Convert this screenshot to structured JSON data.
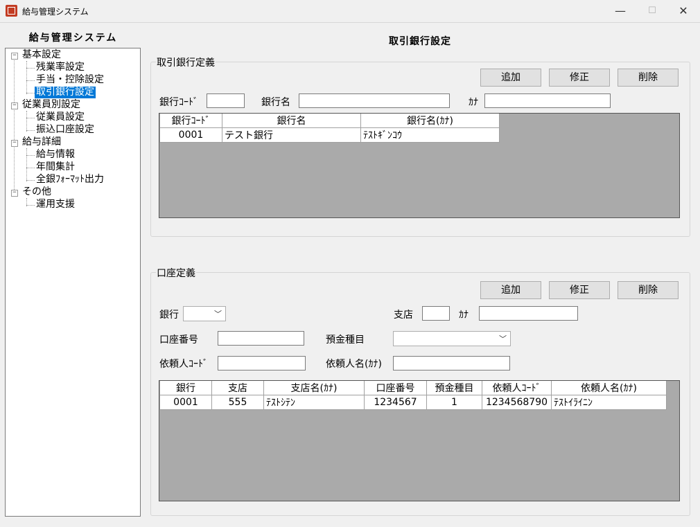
{
  "window": {
    "title": "給与管理システム"
  },
  "sidebar": {
    "title": "給与管理システム",
    "tree": [
      {
        "label": "基本設定"
      },
      {
        "label": "残業率設定"
      },
      {
        "label": "手当・控除設定"
      },
      {
        "label": "取引銀行設定",
        "selected": true
      },
      {
        "label": "従業員別設定"
      },
      {
        "label": "従業員設定"
      },
      {
        "label": "振込口座設定"
      },
      {
        "label": "給与詳細"
      },
      {
        "label": "給与情報"
      },
      {
        "label": "年間集計"
      },
      {
        "label": "全銀ﾌｫｰﾏｯﾄ出力"
      },
      {
        "label": "その他"
      },
      {
        "label": "運用支援"
      }
    ]
  },
  "main": {
    "title": "取引銀行設定",
    "bank_group": {
      "legend": "取引銀行定義",
      "buttons": {
        "add": "追加",
        "edit": "修正",
        "delete": "削除"
      },
      "labels": {
        "code": "銀行ｺｰﾄﾞ",
        "name": "銀行名",
        "kana": "ｶﾅ"
      },
      "fields": {
        "code": "",
        "name": "",
        "kana": ""
      },
      "grid": {
        "headers": [
          "銀行ｺｰﾄﾞ",
          "銀行名",
          "銀行名(ｶﾅ)"
        ],
        "rows": [
          [
            "0001",
            "テスト銀行",
            "ﾃｽﾄｷﾞﾝｺｳ"
          ]
        ]
      }
    },
    "account_group": {
      "legend": "口座定義",
      "buttons": {
        "add": "追加",
        "edit": "修正",
        "delete": "削除"
      },
      "labels": {
        "bank": "銀行",
        "branch": "支店",
        "kana": "ｶﾅ",
        "account_no": "口座番号",
        "deposit_type": "預金種目",
        "requester_code": "依頼人ｺｰﾄﾞ",
        "requester_name": "依頼人名(ｶﾅ)"
      },
      "fields": {
        "bank": "",
        "branch": "",
        "kana": "",
        "account_no": "",
        "deposit_type": "",
        "requester_code": "",
        "requester_name": ""
      },
      "grid": {
        "headers": [
          "銀行",
          "支店",
          "支店名(ｶﾅ)",
          "口座番号",
          "預金種目",
          "依頼人ｺｰﾄﾞ",
          "依頼人名(ｶﾅ)"
        ],
        "rows": [
          [
            "0001",
            "555",
            "ﾃｽﾄｼﾃﾝ",
            "1234567",
            "1",
            "1234568790",
            "ﾃｽﾄｲﾗｲﾆﾝ"
          ]
        ]
      }
    }
  },
  "icons": {
    "app": "app-icon",
    "minimize": "minimize-icon",
    "maximize": "maximize-icon",
    "close": "close-icon",
    "dropdown": "chevron-down-icon"
  },
  "colors": {
    "selection": "#0078d7",
    "grid_bg": "#aaaaaa",
    "window_bg": "#f0f0f0"
  }
}
